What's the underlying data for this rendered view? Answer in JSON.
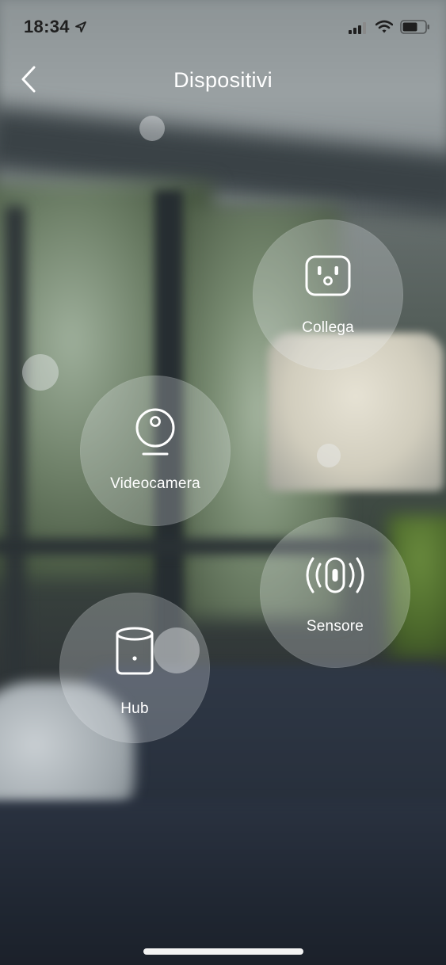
{
  "status_bar": {
    "time": "18:34"
  },
  "header": {
    "title": "Dispositivi"
  },
  "devices": [
    {
      "label": "Collega",
      "icon": "smart-plug-icon"
    },
    {
      "label": "Videocamera",
      "icon": "camera-icon"
    },
    {
      "label": "Sensore",
      "icon": "motion-sensor-icon"
    },
    {
      "label": "Hub",
      "icon": "hub-icon"
    }
  ],
  "colors": {
    "text": "#ffffff",
    "bubble": "rgba(236,240,242,0.26)"
  }
}
